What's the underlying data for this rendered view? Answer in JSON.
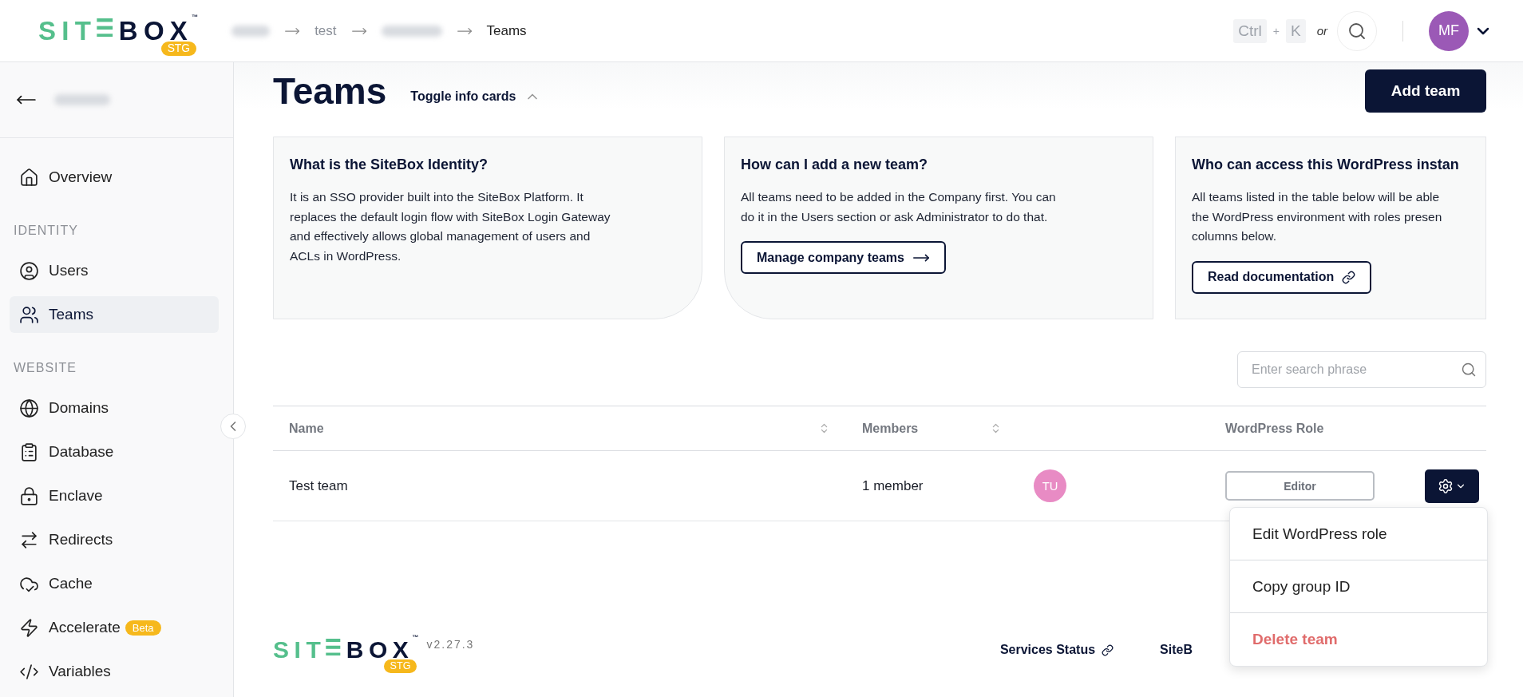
{
  "logo": {
    "green": "SIT",
    "navy": "BOX",
    "tm": "™",
    "badge": "STG"
  },
  "breadcrumbs": [
    {
      "kind": "blurred"
    },
    {
      "kind": "text",
      "label": "test",
      "current": false
    },
    {
      "kind": "blurred"
    },
    {
      "kind": "text",
      "label": "Teams",
      "current": true
    }
  ],
  "shortcut": {
    "keys": [
      "Ctrl",
      "K"
    ],
    "plus": "+",
    "or": "or"
  },
  "user": {
    "initials": "MF",
    "color": "#9b59b6"
  },
  "sidebar": {
    "back": {
      "kind": "blurred"
    },
    "items": [
      {
        "kind": "item",
        "label": "Overview",
        "selected": false
      },
      {
        "kind": "section",
        "label": "IDENTITY"
      },
      {
        "kind": "item",
        "label": "Users",
        "selected": false
      },
      {
        "kind": "item",
        "label": "Teams",
        "selected": true
      },
      {
        "kind": "section",
        "label": "WEBSITE"
      },
      {
        "kind": "item",
        "label": "Domains",
        "selected": false
      },
      {
        "kind": "item",
        "label": "Database",
        "selected": false
      },
      {
        "kind": "item",
        "label": "Enclave",
        "selected": false
      },
      {
        "kind": "item",
        "label": "Redirects",
        "selected": false
      },
      {
        "kind": "item",
        "label": "Cache",
        "selected": false
      },
      {
        "kind": "item",
        "label": "Accelerate",
        "badge": "Beta",
        "selected": false
      },
      {
        "kind": "item",
        "label": "Variables",
        "selected": false
      }
    ]
  },
  "page": {
    "title": "Teams",
    "toggle": {
      "label": "Toggle info cards",
      "expanded": true
    },
    "add_button": "Add team"
  },
  "cards": [
    {
      "title": "What is the SiteBox Identity?",
      "lines": [
        "It is an SSO provider built into the SiteBox Platform. It",
        "replaces the default login flow with SiteBox Login Gateway",
        "and effectively allows global management of users and",
        "ACLs in WordPress."
      ]
    },
    {
      "title": "How can I add a new team?",
      "lines": [
        "All teams need to be added in the Company first. You can",
        "do it in the Users section or ask Administrator to do that."
      ],
      "button": {
        "label": "Manage company teams",
        "kind": "arrow"
      }
    },
    {
      "title": "Who can access this WordPress instan",
      "lines": [
        "All teams listed in the table below will be able",
        "the WordPress environment with roles presen",
        "columns below."
      ],
      "button": {
        "label": "Read documentation",
        "kind": "link"
      }
    }
  ],
  "search": {
    "placeholder": "Enter search phrase"
  },
  "table": {
    "columns": [
      {
        "label": "Name",
        "sortable": true
      },
      {
        "label": "Members",
        "sortable": true
      },
      {
        "label": "WordPress Role",
        "sortable": false
      }
    ],
    "rows": [
      {
        "name": "Test team",
        "members": "1 member",
        "avatars": [
          {
            "initials": "TU",
            "color": "#e88bc4"
          }
        ],
        "role": "Editor",
        "menu_open": true
      }
    ]
  },
  "menu": [
    {
      "label": "Edit WordPress role",
      "kind": "normal"
    },
    {
      "label": "Copy group ID",
      "kind": "normal"
    },
    {
      "label": "Delete team",
      "kind": "danger"
    }
  ],
  "footer": {
    "logo": {
      "green": "SIT",
      "navy": "BOX",
      "tm": "™",
      "badge": "STG"
    },
    "version": "v2.27.3",
    "links": [
      {
        "label": "Services Status",
        "kind": "link"
      },
      {
        "label": "SiteB",
        "kind": "plain"
      }
    ]
  }
}
